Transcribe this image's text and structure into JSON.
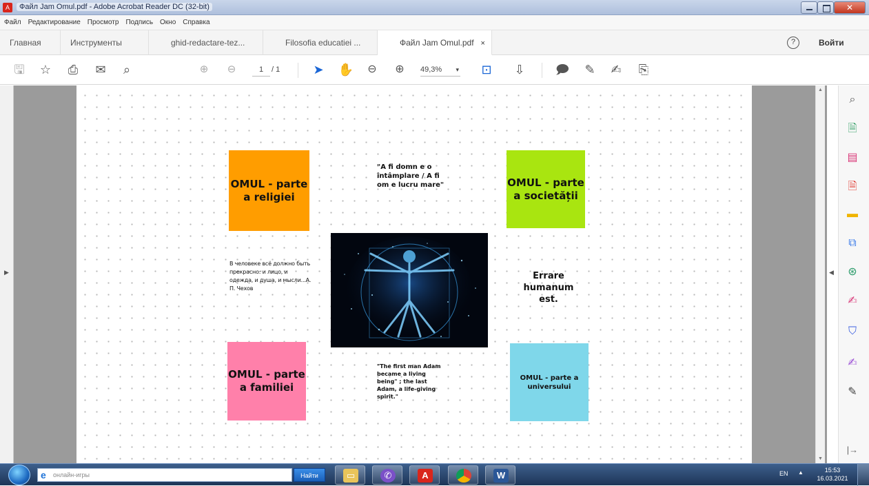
{
  "window": {
    "title": "Файл Jam Omul.pdf - Adobe Acrobat Reader DC (32-bit)",
    "app_icon": "acrobat-icon"
  },
  "menu": [
    "Файл",
    "Редактирование",
    "Просмотр",
    "Подпись",
    "Окно",
    "Справка"
  ],
  "tabs": {
    "home": "Главная",
    "tools": "Инструменты",
    "doc1": "ghid-redactare-tez...",
    "doc2": "Filosofia educatiei ...",
    "doc3": "Файл Jam Omul.pdf",
    "close": "×",
    "help": "?",
    "signin": "Войти"
  },
  "toolbar": {
    "page_current": "1",
    "page_total": "/ 1",
    "zoom": "49,3%",
    "icons": [
      "save-icon",
      "bookmark-star-icon",
      "print-icon",
      "email-icon",
      "search-zoom-icon",
      "page-up-icon",
      "page-down-icon",
      "select-pointer-icon",
      "hand-pan-icon",
      "zoom-out-icon",
      "zoom-in-icon",
      "fit-page-icon",
      "scroll-mode-icon",
      "comment-icon",
      "highlight-pen-icon",
      "sign-icon",
      "share-icon"
    ]
  },
  "page": {
    "note_orange": "OMUL - parte a religiei",
    "note_green": "OMUL - parte a societății",
    "note_pink": "OMUL - parte a familiei",
    "note_blue": "OMUL - parte a universului",
    "quote_domn": "\"A fi domn e o întâmplare / A fi om e lucru mare\"",
    "quote_chekhov": "В человеке всё должно быть прекрасно: и лицо, и одежда, и душа, и мысли...А. П. Чехов",
    "errare": "Errare humanum est.",
    "quote_adam": "\"The first man Adam became a living being\" ; the last Adam, a life-giving spirit.\"",
    "colors": {
      "orange": "#ff9d00",
      "green": "#a9e510",
      "pink": "#ff80aa",
      "blue": "#7fd7ea"
    }
  },
  "rightpane": [
    "zoom-icon",
    "export-pdf-icon",
    "organize-pages-icon",
    "create-pdf-icon",
    "comment-icon",
    "edit-pdf-icon",
    "scan-icon",
    "fill-sign-icon",
    "protect-icon",
    "signature-icon",
    "more-tools-icon",
    "collapse-pane-icon"
  ],
  "taskbar": {
    "search_placeholder": "онлайн-игры",
    "find_button": "Найти",
    "apps": [
      "explorer-icon",
      "viber-icon",
      "acrobat-icon",
      "chrome-icon",
      "word-icon"
    ],
    "lang": "EN",
    "time": "15:53",
    "date": "16.03.2021"
  }
}
